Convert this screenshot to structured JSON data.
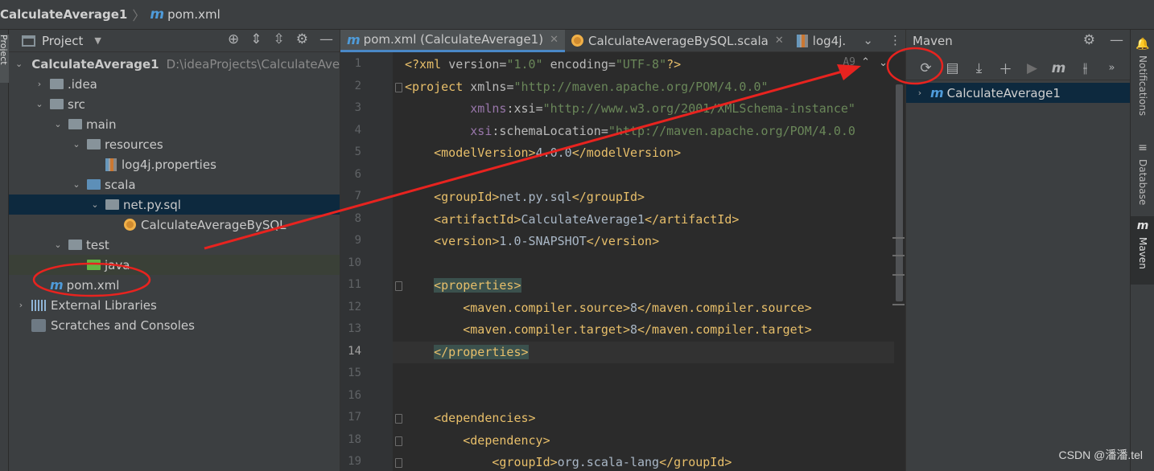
{
  "breadcrumb": {
    "project": "CalculateAverage1",
    "file": "pom.xml"
  },
  "left_stripe_label": "Project",
  "project_panel": {
    "title": "Project",
    "tree": [
      {
        "label": "CalculateAverage1",
        "path": "D:\\ideaProjects\\CalculateAve",
        "level": 0,
        "expanded": true,
        "kind": "module"
      },
      {
        "label": ".idea",
        "level": 1,
        "expanded": false,
        "kind": "folder"
      },
      {
        "label": "src",
        "level": 1,
        "expanded": true,
        "kind": "folder"
      },
      {
        "label": "main",
        "level": 2,
        "expanded": true,
        "kind": "folder"
      },
      {
        "label": "resources",
        "level": 3,
        "expanded": true,
        "kind": "folder"
      },
      {
        "label": "log4j.properties",
        "level": 4,
        "kind": "properties"
      },
      {
        "label": "scala",
        "level": 3,
        "expanded": true,
        "kind": "folder-blue"
      },
      {
        "label": "net.py.sql",
        "level": 4,
        "expanded": true,
        "kind": "package",
        "selected": true
      },
      {
        "label": "CalculateAverageBySQL",
        "level": 5,
        "kind": "scala"
      },
      {
        "label": "test",
        "level": 2,
        "expanded": true,
        "kind": "folder"
      },
      {
        "label": "java",
        "level": 3,
        "kind": "folder-green",
        "highlighted": true
      },
      {
        "label": "pom.xml",
        "level": 1,
        "kind": "maven"
      },
      {
        "label": "External Libraries",
        "level": 0,
        "expanded": false,
        "kind": "libraries"
      },
      {
        "label": "Scratches and Consoles",
        "level": 0,
        "kind": "scratches"
      }
    ]
  },
  "editor": {
    "tabs": [
      {
        "label": "pom.xml (CalculateAverage1)",
        "icon": "maven-icon",
        "active": true
      },
      {
        "label": "CalculateAverageBySQL.scala",
        "icon": "scala-icon",
        "active": false
      },
      {
        "label": "log4j.",
        "icon": "properties-icon",
        "active": false
      }
    ],
    "inspection_label": "A9",
    "current_line": 14,
    "line_numbers": [
      "1",
      "2",
      "3",
      "4",
      "5",
      "6",
      "7",
      "8",
      "9",
      "10",
      "11",
      "12",
      "13",
      "14",
      "15",
      "16",
      "17",
      "18",
      "19"
    ],
    "lines": [
      "<?xml version=\"1.0\" encoding=\"UTF-8\"?>",
      "<project xmlns=\"http://maven.apache.org/POM/4.0.0\"",
      "         xmlns:xsi=\"http://www.w3.org/2001/XMLSchema-instance\"",
      "         xsi:schemaLocation=\"http://maven.apache.org/POM/4.0.0",
      "    <modelVersion>4.0.0</modelVersion>",
      "",
      "    <groupId>net.py.sql</groupId>",
      "    <artifactId>CalculateAverage1</artifactId>",
      "    <version>1.0-SNAPSHOT</version>",
      "",
      "    <properties>",
      "        <maven.compiler.source>8</maven.compiler.source>",
      "        <maven.compiler.target>8</maven.compiler.target>",
      "    </properties>",
      "",
      "",
      "    <dependencies>",
      "        <dependency>",
      "            <groupId>org.scala-lang</groupId>"
    ]
  },
  "maven_panel": {
    "title": "Maven",
    "toolbar": [
      "reload-icon",
      "add-source-icon",
      "download-icon",
      "plus-icon",
      "run-icon",
      "maven-goal-icon",
      "toggle-offline-icon",
      "more-icon"
    ],
    "tree_root": "CalculateAverage1"
  },
  "right_stripe": [
    {
      "label": "Notifications",
      "icon": "bell-icon"
    },
    {
      "label": "Database",
      "icon": "database-icon"
    },
    {
      "label": "Maven",
      "icon": "maven-icon",
      "active": true
    }
  ],
  "watermark": "CSDN @潘潘.tel",
  "colors": {
    "annotation": "#e8231f",
    "selection": "#0d293e",
    "accent": "#4a88c7"
  }
}
